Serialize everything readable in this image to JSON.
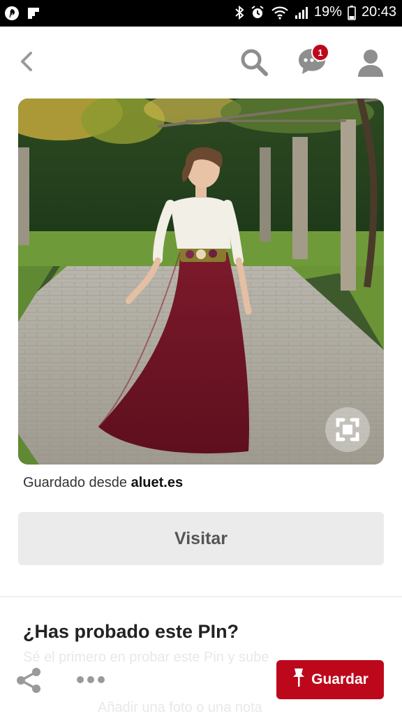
{
  "status_bar": {
    "battery": "19%",
    "time": "20:43",
    "icons": [
      "pinterest-icon",
      "flipboard-icon",
      "bluetooth-icon",
      "alarm-icon",
      "wifi-icon",
      "signal-icon",
      "battery-icon"
    ]
  },
  "header": {
    "icons": [
      "back-arrow-icon",
      "search-icon",
      "chat-icon",
      "user-icon"
    ],
    "notification_count": "1"
  },
  "pin": {
    "image_description_icon": "visual-search-icon",
    "source_prefix": "Guardado desde",
    "source_domain": "aluet.es",
    "visit_label": "Visitar"
  },
  "suggestions": {
    "title": "¿Has probado este PIn?",
    "faded_line_1": "Sé el primero en probar este Pin y sube",
    "faded_line_2": "Añadir una foto o una nota"
  },
  "action_bar": {
    "save_label": "Guardar",
    "icons": [
      "share-icon",
      "more-icon",
      "pin-icon"
    ]
  },
  "colors": {
    "brand_red": "#bd081c",
    "skirt": "#6e1424",
    "visit_button_bg": "#ebebeb"
  }
}
